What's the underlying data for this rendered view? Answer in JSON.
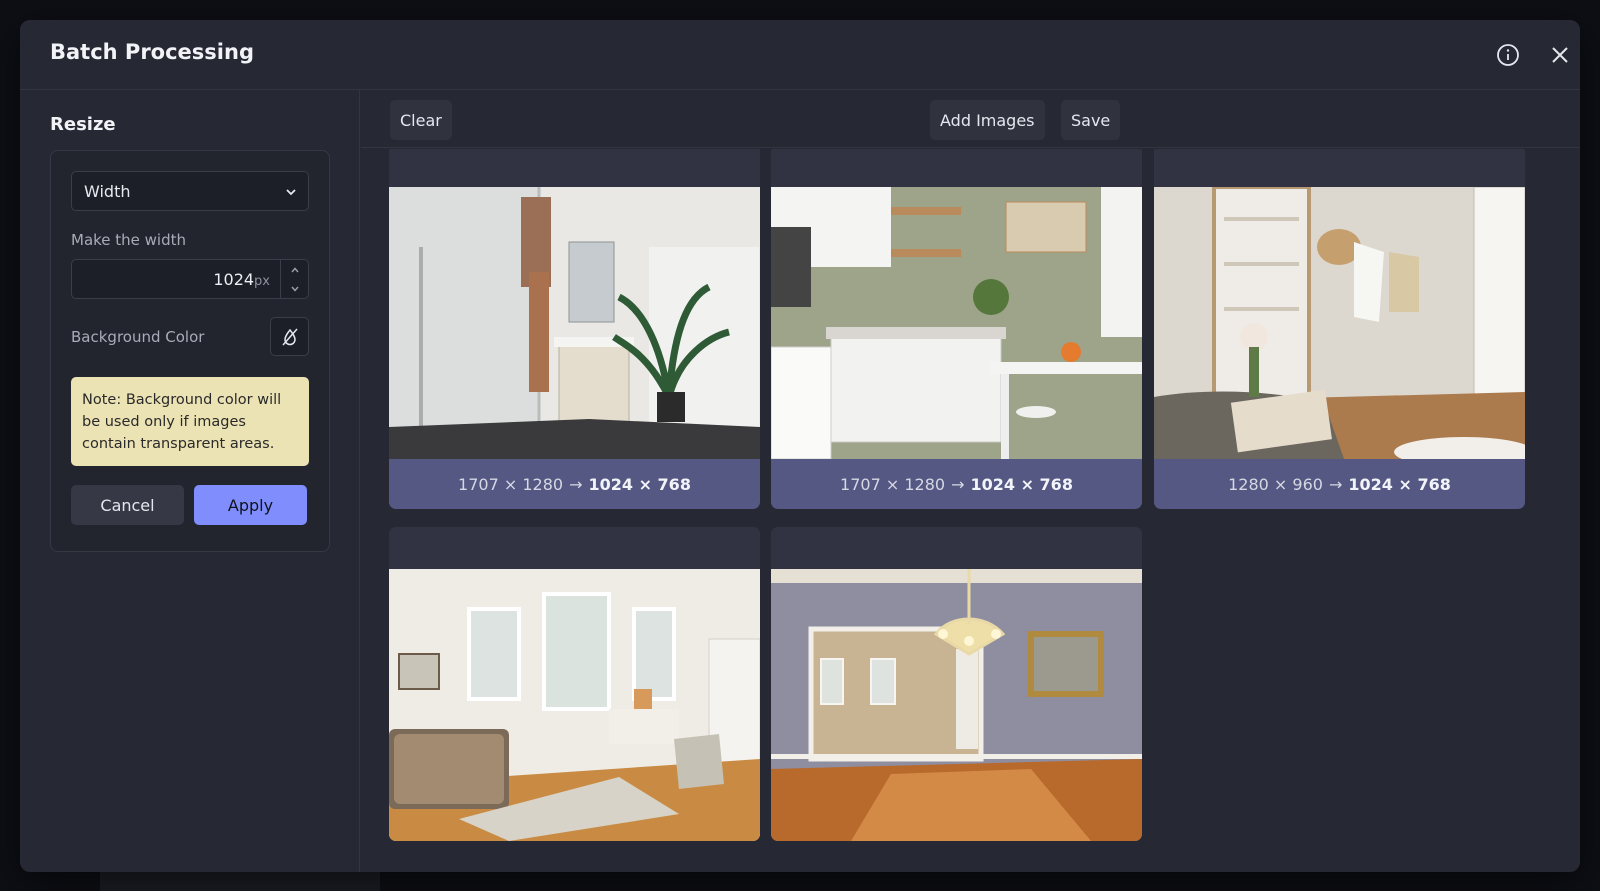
{
  "dialog": {
    "title": "Batch Processing",
    "info_icon": "info-circle-icon",
    "close_icon": "close-icon"
  },
  "sidebar": {
    "section_title": "Resize",
    "mode_select": {
      "value": "Width"
    },
    "width_label": "Make the width",
    "width_value": "1024",
    "width_unit": "px",
    "bg_color_label": "Background Color",
    "bg_color_icon": "no-color-icon",
    "note": "Note: Background color will be used only if images contain transparent areas.",
    "cancel_label": "Cancel",
    "apply_label": "Apply"
  },
  "toolbar": {
    "clear_label": "Clear",
    "add_images_label": "Add Images",
    "save_label": "Save"
  },
  "images": [
    {
      "scene": "bathroom",
      "original": "1707 × 1280",
      "result": "1024 × 768"
    },
    {
      "scene": "kitchen",
      "original": "1707 × 1280",
      "result": "1024 × 768"
    },
    {
      "scene": "bedroom",
      "original": "1280 × 960",
      "result": "1024 × 768"
    },
    {
      "scene": "living room",
      "original": "",
      "result": ""
    },
    {
      "scene": "dining room",
      "original": "",
      "result": ""
    }
  ],
  "colors": {
    "accent": "#7f8efc",
    "caption_bar": "#545882",
    "note_bg": "#ece3b5"
  }
}
